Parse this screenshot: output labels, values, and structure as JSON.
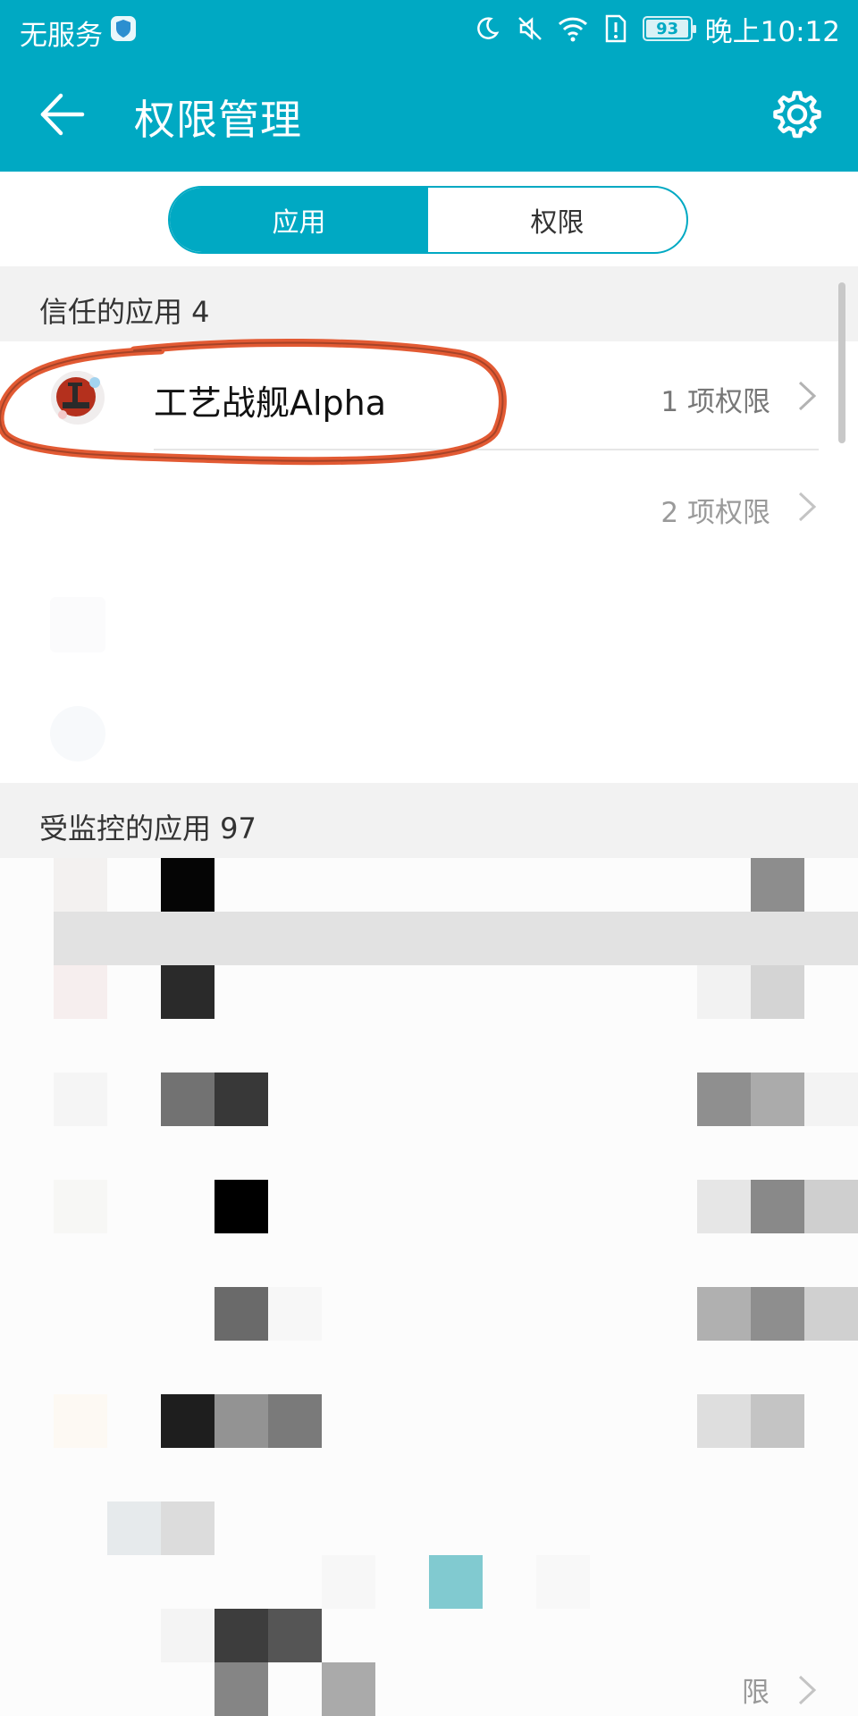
{
  "status_bar": {
    "carrier": "无服务",
    "battery": "93",
    "time": "晚上10:12",
    "icons": [
      "moon-icon",
      "mute-icon",
      "wifi-icon",
      "sim-alert-icon",
      "battery-icon"
    ]
  },
  "header": {
    "title": "权限管理",
    "back_icon": "back-arrow-icon",
    "settings_icon": "gear-icon",
    "color": "#00a9c3"
  },
  "tabs": [
    {
      "label": "应用",
      "active": true
    },
    {
      "label": "权限",
      "active": false
    }
  ],
  "trusted": {
    "header": "信任的应用 4",
    "apps": [
      {
        "name": "工艺战舰Alpha",
        "permissions": "1 项权限"
      },
      {
        "name": "",
        "permissions": "2 项权限"
      }
    ]
  },
  "monitored": {
    "header": "受监控的应用 97",
    "partial_label": "限"
  }
}
